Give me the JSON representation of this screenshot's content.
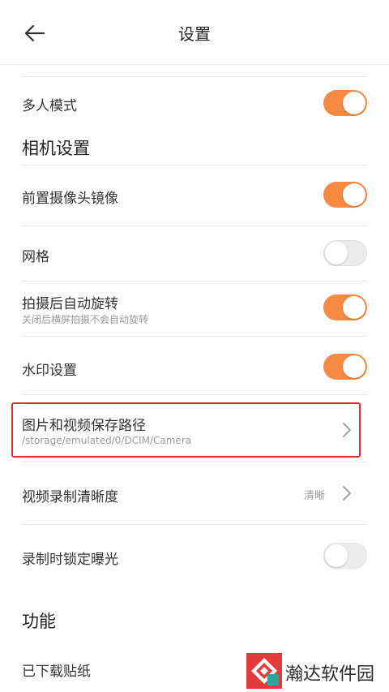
{
  "header": {
    "title": "设置"
  },
  "multi_user": {
    "label": "多人模式",
    "enabled": true
  },
  "camera_section": {
    "title": "相机设置"
  },
  "mirror": {
    "label": "前置摄像头镜像",
    "enabled": true
  },
  "grid": {
    "label": "网格",
    "enabled": false
  },
  "auto_rotate": {
    "label": "拍摄后自动旋转",
    "subtitle": "关闭后横屏拍摄不会自动旋转",
    "enabled": true
  },
  "watermark": {
    "label": "水印设置",
    "enabled": true
  },
  "save_path": {
    "label": "图片和视频保存路径",
    "value": "/storage/emulated/0/DCIM/Camera"
  },
  "video_quality": {
    "label": "视频录制清晰度",
    "value": "清晰"
  },
  "lock_exposure": {
    "label": "录制时锁定曝光",
    "enabled": false
  },
  "function_section": {
    "title": "功能"
  },
  "stickers": {
    "label": "已下载贴纸"
  },
  "brand": {
    "text": "瀚达软件园"
  },
  "colors": {
    "toggle_on": "#f68a43",
    "highlight": "#e02b2b"
  }
}
